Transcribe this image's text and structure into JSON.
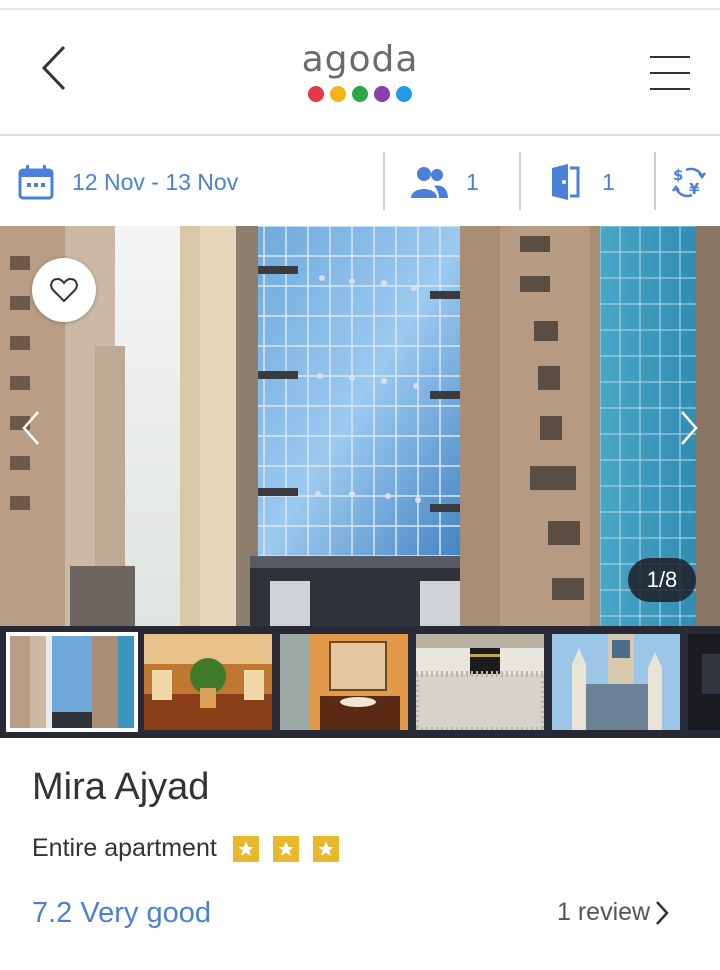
{
  "header": {
    "logo_text": "agoda",
    "logo_dot_colors": [
      "#e8364a",
      "#f5b31b",
      "#2aa843",
      "#8b3fa8",
      "#1e9ee0"
    ]
  },
  "search": {
    "dates": "12 Nov - 13 Nov",
    "guests": "1",
    "rooms": "1"
  },
  "gallery": {
    "counter": "1/8",
    "thumbnails": [
      "hotel-exterior",
      "lobby",
      "bathroom",
      "kaaba",
      "clock-tower"
    ]
  },
  "property": {
    "name": "Mira Ajyad",
    "type": "Entire apartment",
    "star_count": 3,
    "rating": "7.2 Very good",
    "reviews": "1 review"
  },
  "colors": {
    "accent": "#4a80d8",
    "star": "#e8b92b",
    "strip": "#272935"
  }
}
